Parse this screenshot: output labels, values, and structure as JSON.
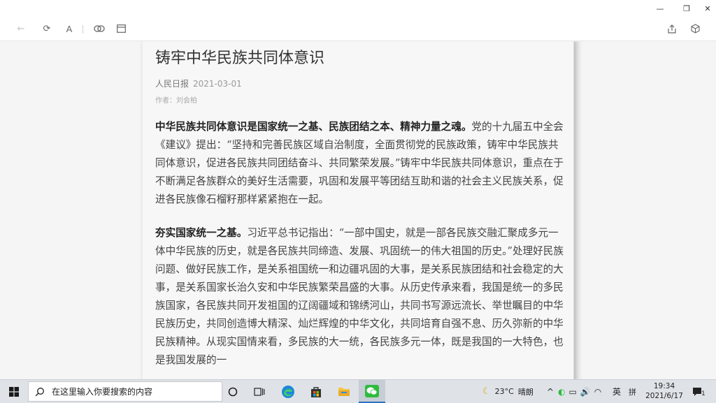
{
  "window": {
    "minimize_glyph": "—",
    "restore_glyph": "❐",
    "close_glyph": "✕"
  },
  "toolbar": {
    "back_glyph": "←",
    "refresh_glyph": "⟳",
    "font_glyph": "A",
    "link_glyph": "⊖",
    "layout_glyph": "▤",
    "share_glyph": "⇪",
    "cube_glyph": "⬡"
  },
  "article": {
    "title": "铸牢中华民族共同体意识",
    "source": "人民日报",
    "date": "2021-03-01",
    "author": "作者：刘会柏",
    "paragraphs": [
      {
        "lead": "中华民族共同体意识是国家统一之基、民族团结之本、精神力量之魂。",
        "body": "党的十九届五中全会《建议》提出：“坚持和完善民族区域自治制度，全面贯彻党的民族政策，铸牢中华民族共同体意识，促进各民族共同团结奋斗、共同繁荣发展。”铸牢中华民族共同体意识，重点在于不断满足各族群众的美好生活需要，巩固和发展平等团结互助和谐的社会主义民族关系，促进各民族像石榴籽那样紧紧抱在一起。"
      },
      {
        "lead": "夯实国家统一之基。",
        "body": "习近平总书记指出：“一部中国史，就是一部各民族交融汇聚成多元一体中华民族的历史，就是各民族共同缔造、发展、巩固统一的伟大祖国的历史。”处理好民族问题、做好民族工作，是关系祖国统一和边疆巩固的大事，是关系民族团结和社会稳定的大事，是关系国家长治久安和中华民族繁荣昌盛的大事。从历史传承来看，我国是统一的多民族国家，各民族共同开发祖国的辽阔疆域和锦绣河山，共同书写源远流长、举世瞩目的中华民族历史，共同创造博大精深、灿烂辉煌的中华文化，共同培育自强不息、历久弥新的中华民族精神。从现实国情来看，多民族的大一统，各民族多元一体，既是我国的一大特色，也是我国发展的一"
      }
    ]
  },
  "taskbar": {
    "search_placeholder": "在这里输入你要搜索的内容",
    "weather_temp": "23°C",
    "weather_desc": "晴朗",
    "ime_lang": "英",
    "ime_mode": "拼",
    "time": "19:34",
    "date": "2021/6/17",
    "notification_count": "1"
  },
  "colors": {
    "accent_wechat": "#2ebc3e",
    "edge_blue": "#1e88d6"
  }
}
